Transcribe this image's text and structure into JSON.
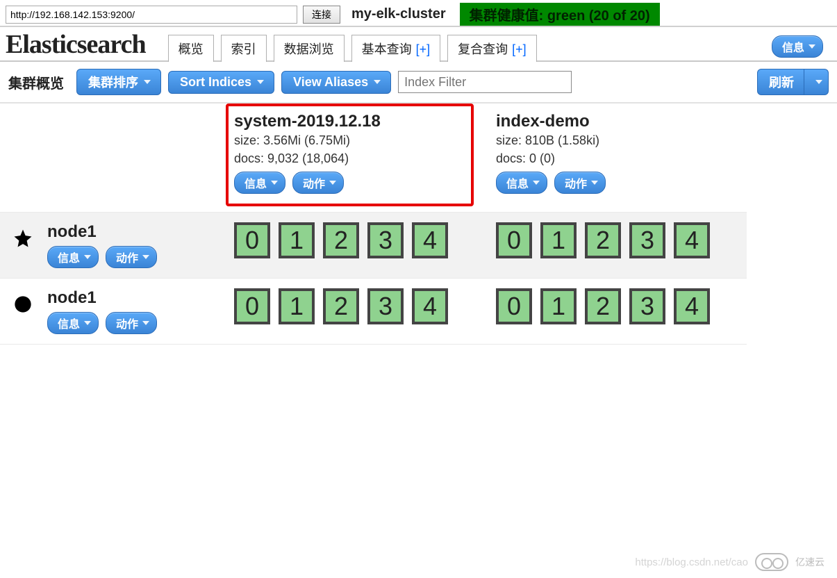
{
  "header": {
    "url": "http://192.168.142.153:9200/",
    "connect_label": "连接",
    "cluster_name": "my-elk-cluster",
    "health_text": "集群健康值: green (20 of 20)",
    "logo": "Elasticsearch",
    "info_btn": "信息"
  },
  "tabs": [
    {
      "label": "概览",
      "active": true,
      "plus": false
    },
    {
      "label": "索引",
      "active": false,
      "plus": false
    },
    {
      "label": "数据浏览",
      "active": false,
      "plus": false
    },
    {
      "label": "基本查询",
      "active": false,
      "plus": true
    },
    {
      "label": "复合查询",
      "active": false,
      "plus": true
    }
  ],
  "toolbar": {
    "title": "集群概览",
    "sort_cluster": "集群排序",
    "sort_indices": "Sort Indices",
    "view_aliases": "View Aliases",
    "filter_placeholder": "Index Filter",
    "refresh": "刷新"
  },
  "indices": [
    {
      "name": "system-2019.12.18",
      "size": "size: 3.56Mi (6.75Mi)",
      "docs": "docs: 9,032 (18,064)",
      "highlighted": true
    },
    {
      "name": "index-demo",
      "size": "size: 810B (1.58ki)",
      "docs": "docs: 0 (0)",
      "highlighted": false
    }
  ],
  "buttons": {
    "info": "信息",
    "action": "动作"
  },
  "nodes": [
    {
      "name": "node1",
      "master": true,
      "shards": [
        [
          0,
          1,
          2,
          3,
          4
        ],
        [
          0,
          1,
          2,
          3,
          4
        ]
      ]
    },
    {
      "name": "node1",
      "master": false,
      "shards": [
        [
          0,
          1,
          2,
          3,
          4
        ],
        [
          0,
          1,
          2,
          3,
          4
        ]
      ]
    }
  ],
  "watermark": {
    "url": "https://blog.csdn.net/cao",
    "brand": "亿速云"
  }
}
